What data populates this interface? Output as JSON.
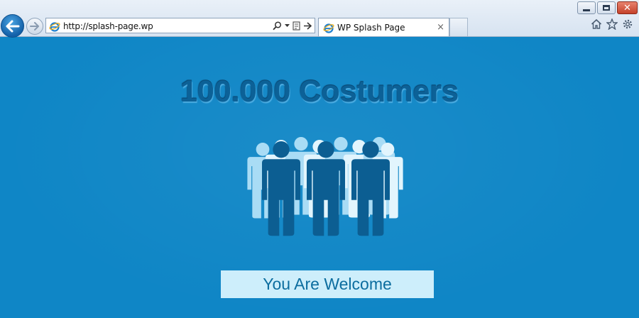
{
  "browser": {
    "url": "http://splash-page.wp",
    "tab_title": "WP Splash Page",
    "tab_close": "×",
    "window_controls": [
      "minimize-icon",
      "restore-icon",
      "close-icon"
    ],
    "close_glyph": "✕",
    "toolbar_icons": [
      "home-icon",
      "favorites-star-icon",
      "settings-gear-icon"
    ],
    "address_tools": [
      "search-icon",
      "dropdown-icon",
      "compatibility-icon",
      "go-arrow-icon"
    ]
  },
  "page": {
    "headline": "100.000 Costumers",
    "welcome_label": "You Are Welcome",
    "illustration": "crowd-of-people-icon",
    "colors": {
      "background": "#0f86c6",
      "headline": "#0c6197",
      "people_front": "#0c5e92",
      "people_back": "#e2f5fd",
      "people_back_alt": "#a9dcf5",
      "welcome_box": "#cdeefb",
      "welcome_text": "#0c6d9f"
    }
  }
}
